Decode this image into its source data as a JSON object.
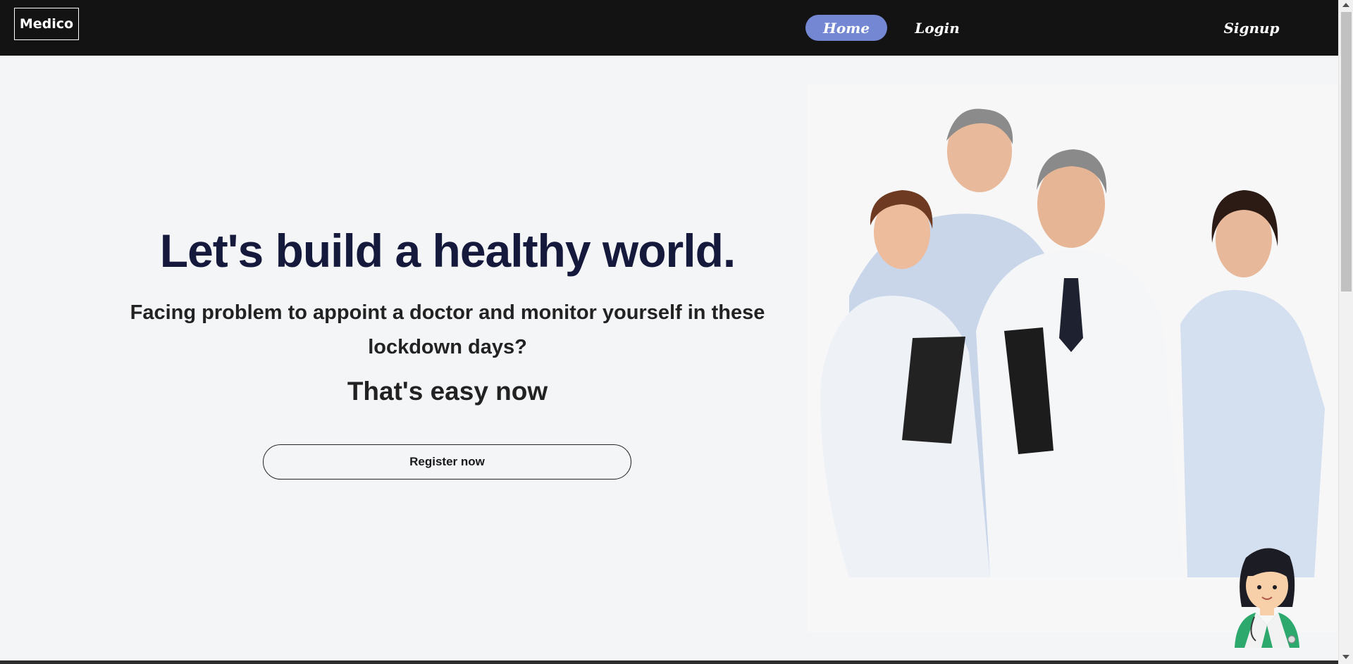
{
  "nav": {
    "logo": "Medico",
    "links": {
      "home": "Home",
      "login": "Login",
      "signup": "Signup"
    },
    "active": "home",
    "active_color": "#7487d3",
    "background": "#131313"
  },
  "hero": {
    "title": "Let's build a healthy world.",
    "subtitle": "Facing problem to appoint a doctor and monitor yourself in these lockdown days?",
    "tagline": "That's easy now",
    "cta": "Register now",
    "image_icon": "doctors-team-photo",
    "title_color": "#151a3d"
  },
  "chatbot": {
    "icon": "doctor-avatar-icon"
  }
}
